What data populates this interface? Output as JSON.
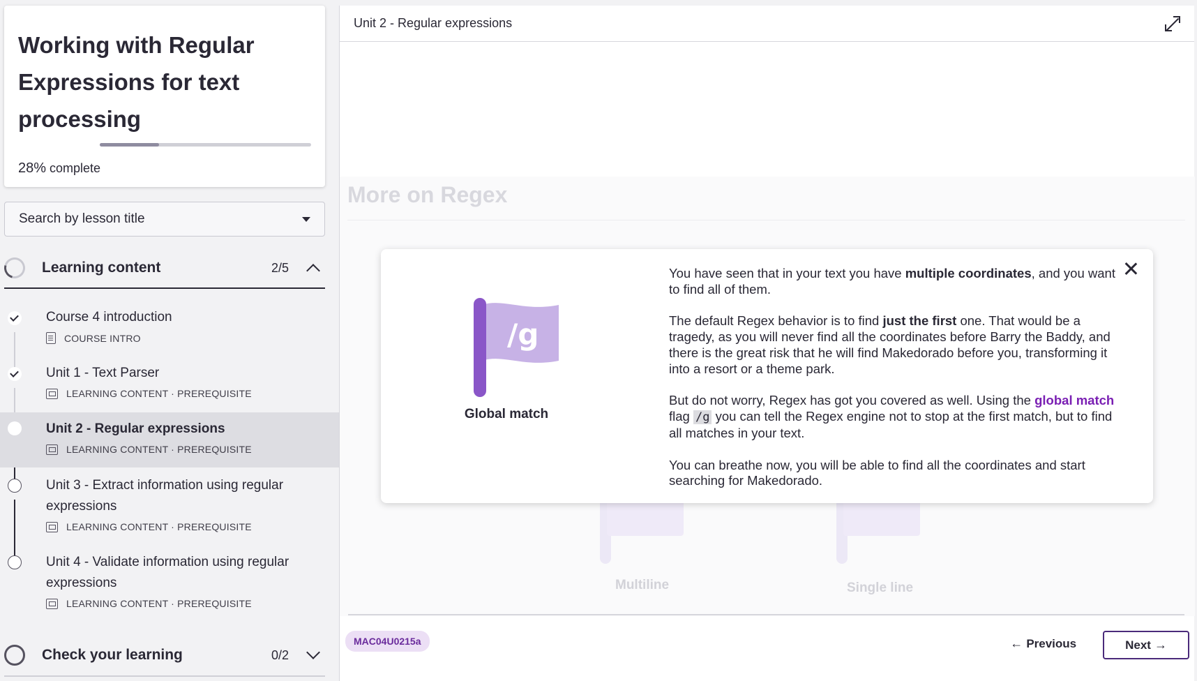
{
  "course": {
    "title": "Working with Regular Expressions for text processing",
    "progress_value": "28%",
    "progress_fraction": 0.28,
    "progress_suffix": " complete"
  },
  "search": {
    "placeholder": "Search by lesson title"
  },
  "sections": [
    {
      "title": "Learning content",
      "count": "2/5"
    },
    {
      "title": "Check your learning",
      "count": "0/2"
    }
  ],
  "lessons": [
    {
      "title": "Course 4 introduction",
      "meta": "COURSE INTRO",
      "status": "done"
    },
    {
      "title": "Unit 1 - Text Parser",
      "meta": "LEARNING CONTENT · PREREQUISITE",
      "status": "done"
    },
    {
      "title": "Unit 2 - Regular expressions",
      "meta": "LEARNING CONTENT · PREREQUISITE",
      "status": "active"
    },
    {
      "title": "Unit 3 - Extract information using regular expressions",
      "meta": "LEARNING CONTENT · PREREQUISITE",
      "status": "todo"
    },
    {
      "title": "Unit 4 - Validate information using regular expressions",
      "meta": "LEARNING CONTENT · PREREQUISITE",
      "status": "todo"
    }
  ],
  "main": {
    "title": "Unit 2 - Regular expressions",
    "background_heading": "More on Regex",
    "background_flags": [
      "Multiline",
      "Single line"
    ]
  },
  "modal": {
    "flag_text": "/g",
    "flag_label": "Global match",
    "p1_a": "You have seen that in your text you have ",
    "p1_b": "multiple coordinates",
    "p1_c": ", and you want to find all of them.",
    "p2_a": "The default Regex behavior is to find ",
    "p2_b": "just the first",
    "p2_c": " one. That would be a tragedy, as you will never find all the coordinates before Barry the Baddy, and there is the great risk that he will find Makedorado before you, transforming it into a resort or a theme park.",
    "p3_a": "But do not worry, Regex has got you covered as well. Using the ",
    "p3_b": "global match",
    "p3_c": " flag ",
    "p3_code": "/g",
    "p3_d": " you can tell the Regex engine not to stop at the first match, but to find all matches in your text.",
    "p4": "You can breathe now, you will be able to find all the coordinates and start searching for Makedorado."
  },
  "footer": {
    "code": "MAC04U0215a",
    "previous": "Previous",
    "next": "Next"
  },
  "colors": {
    "accent": "#7a1fb3",
    "flag": "#8a56c8",
    "flag_cloth": "#c7b2e6"
  }
}
